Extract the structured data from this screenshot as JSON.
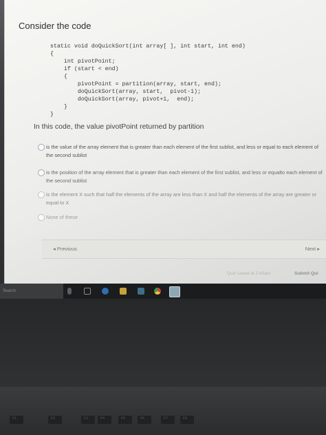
{
  "question": {
    "title": "Consider the code",
    "code_lines": [
      "static void doQuickSort(int array[ ], int start, int end)",
      "{",
      "    int pivotPoint;",
      "    if (start < end)",
      "    {",
      "        pivotPoint = partition(array, start, end);",
      "        doQuickSort(array, start,  pivot-1);",
      "        doQuickSort(array, pivot+1,  end);",
      "    }",
      "}"
    ],
    "prompt": "In this code, the value pivotPoint returned by partition"
  },
  "options": [
    {
      "label": "is the value of the array element that is greater than each element of the first sublist, and less or equal to each element of the second sublist"
    },
    {
      "label": "is the position of the array element that is greater than each element of the first sublist, and less or equalto each element of the second sublist"
    },
    {
      "label": "is the element X such that half the elements of the array are less than X and half the elements of the array are greater or equal to X"
    },
    {
      "label": "None of these"
    }
  ],
  "navigation": {
    "previous_label": "◂ Previous",
    "next_label": "Next ▸"
  },
  "footer": {
    "save_status": "Quiz saved at 2:40am",
    "submit_label": "Submit Qui"
  },
  "taskbar": {
    "search_placeholder": "Search"
  },
  "function_keys": [
    "F1",
    "F2",
    "F3",
    "F4",
    "F5",
    "F6",
    "F7",
    "F8"
  ],
  "colors": {
    "page_background": "#efefec",
    "text": "#444444",
    "radio_border": "#a0a8b0",
    "taskbar": "#1a1c1e"
  },
  "icons": [
    "mic-icon",
    "task-view-icon",
    "edge-icon",
    "file-explorer-icon",
    "store-icon",
    "chrome-icon",
    "app-icon"
  ]
}
